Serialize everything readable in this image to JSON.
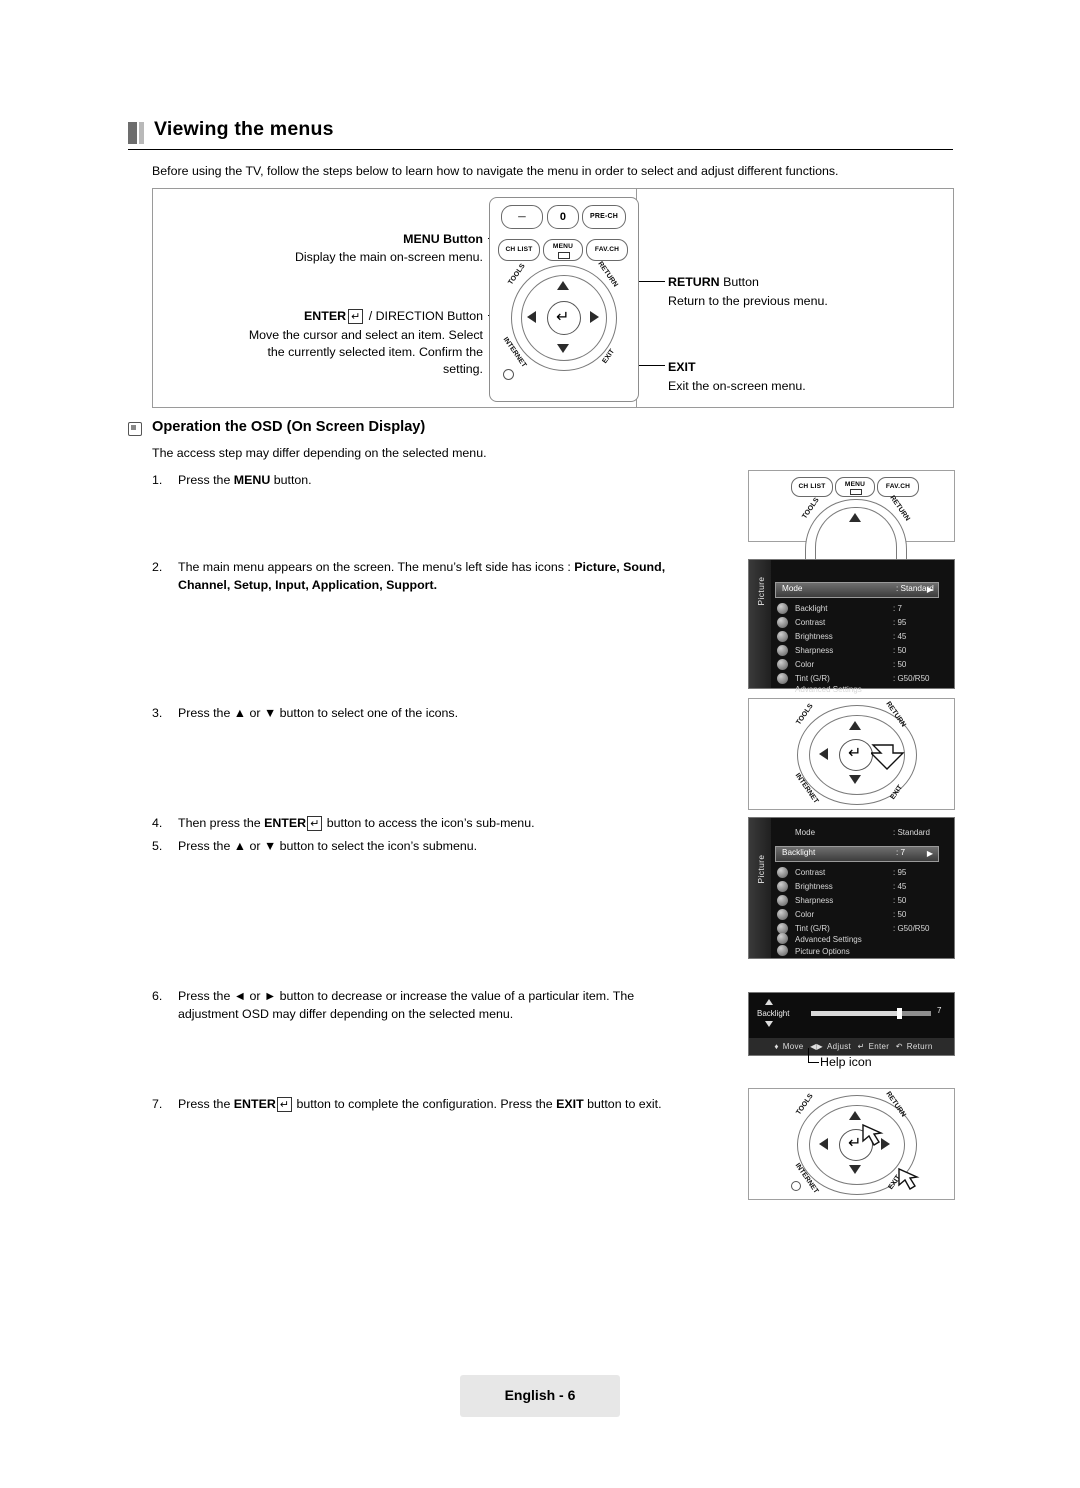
{
  "page": {
    "heading": "Viewing the menus",
    "intro": "Before using the TV, follow the steps below to learn how to navigate the menu in order to select and adjust different functions.",
    "footer": "English - 6"
  },
  "top_diagram": {
    "menu_label": "MENU Button",
    "menu_desc": "Display the main on-screen menu.",
    "enter_label_bold": "ENTER",
    "enter_label_rest": " / DIRECTION Button",
    "enter_desc_line1": "Move the cursor and select an item. Select",
    "enter_desc_line2": "the currently selected item. Confirm the",
    "enter_desc_line3": "setting.",
    "return_label_bold": "RETURN",
    "return_label_rest": " Button",
    "return_desc": "Return to the previous menu.",
    "exit_label": "EXIT",
    "exit_desc": "Exit the on-screen menu.",
    "remote_buttons": {
      "minus": "—",
      "zero": "0",
      "pre_ch": "PRE-CH",
      "ch_list": "CH LIST",
      "menu": "MENU",
      "fav_ch": "FAV.CH",
      "tools": "TOOLS",
      "return": "RETURN",
      "internet": "INTERNET",
      "exit": "EXIT"
    }
  },
  "section": {
    "title": "Operation the OSD (On Screen Display)",
    "note": "The access step may differ depending on the selected menu."
  },
  "steps": [
    {
      "num": "1.",
      "parts": [
        {
          "t": "Press the ",
          "b": false
        },
        {
          "t": "MENU",
          "b": true
        },
        {
          "t": " button.",
          "b": false
        }
      ]
    },
    {
      "num": "2.",
      "line1_a": "The main menu appears on the screen. The menu’s left side has icons : ",
      "line1_b": "Picture, Sound,",
      "line2_b": "Channel, Setup, Input, Application, Support."
    },
    {
      "num": "3.",
      "text": "Press the ▲ or ▼ button to select one of the icons."
    },
    {
      "num": "4.",
      "a": "Then press the ",
      "b": "ENTER",
      "c": " button to access the icon’s sub-menu."
    },
    {
      "num": "5.",
      "text": "Press the ▲ or ▼ button to select the icon’s submenu."
    },
    {
      "num": "6.",
      "line1": "Press the ◄ or ► button to decrease or increase the value of a particular item. The",
      "line2": "adjustment OSD may differ depending on the selected menu."
    },
    {
      "num": "7.",
      "a": "Press the ",
      "b": "ENTER",
      "c": " button to complete the configuration. Press the ",
      "d": "EXIT",
      "e": " button to exit."
    }
  ],
  "osd_main": {
    "strip_label": "Picture",
    "selected": {
      "label": "Mode",
      "value": ": Standard"
    },
    "rows": [
      {
        "label": "Backlight",
        "value": ": 7"
      },
      {
        "label": "Contrast",
        "value": ": 95"
      },
      {
        "label": "Brightness",
        "value": ": 45"
      },
      {
        "label": "Sharpness",
        "value": ": 50"
      },
      {
        "label": "Color",
        "value": ": 50"
      },
      {
        "label": "Tint (G/R)",
        "value": ": G50/R50"
      },
      {
        "label": "Advanced Settings",
        "value": ""
      }
    ]
  },
  "osd_sub": {
    "strip_label": "Picture",
    "top_row": {
      "label": "Mode",
      "value": ": Standard"
    },
    "selected": {
      "label": "Backlight",
      "value": ": 7"
    },
    "rows": [
      {
        "label": "Contrast",
        "value": ": 95"
      },
      {
        "label": "Brightness",
        "value": ": 45"
      },
      {
        "label": "Sharpness",
        "value": ": 50"
      },
      {
        "label": "Color",
        "value": ": 50"
      },
      {
        "label": "Tint (G/R)",
        "value": ": G50/R50"
      },
      {
        "label": "Advanced Settings",
        "value": ""
      },
      {
        "label": "Picture Options",
        "value": ""
      }
    ]
  },
  "osd_bar": {
    "label": "Backlight",
    "value": "7",
    "help": [
      "Move",
      "Adjust",
      "Enter",
      "Return"
    ],
    "help_icon_label": "Help icon"
  },
  "colors": {
    "rule": "#000000",
    "heading_bar": "#6d6d6d",
    "footer_bg": "#e7e7e7",
    "osd_bg": "#111111"
  }
}
